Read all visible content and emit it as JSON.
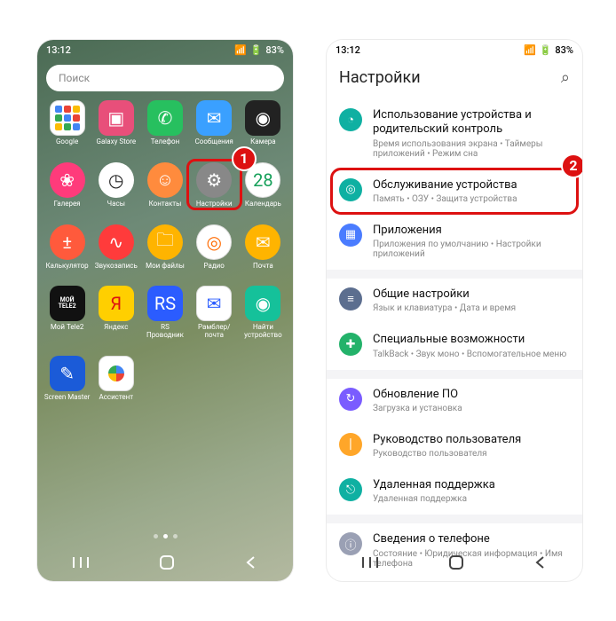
{
  "status": {
    "time": "13:12",
    "battery": "83%"
  },
  "left": {
    "search_placeholder": "Поиск",
    "apps": [
      {
        "label": "Google",
        "icon": "google-folder",
        "bg": "bg-white"
      },
      {
        "label": "Galaxy Store",
        "icon": "▣",
        "bg": "bg-pink"
      },
      {
        "label": "Телефон",
        "icon": "✆",
        "bg": "bg-green"
      },
      {
        "label": "Сообщения",
        "icon": "✉",
        "bg": "bg-msg"
      },
      {
        "label": "Камера",
        "icon": "◉",
        "bg": "bg-cam"
      },
      {
        "label": "Галерея",
        "icon": "❀",
        "bg": "bg-gal"
      },
      {
        "label": "Часы",
        "icon": "◷",
        "bg": "bg-clock"
      },
      {
        "label": "Контакты",
        "icon": "☺",
        "bg": "bg-contact"
      },
      {
        "label": "Настройки",
        "icon": "⚙",
        "bg": "bg-gear"
      },
      {
        "label": "Календарь",
        "icon": "28",
        "bg": "bg-cal"
      },
      {
        "label": "Калькулятор",
        "icon": "±",
        "bg": "bg-calc"
      },
      {
        "label": "Звукозапись",
        "icon": "∿",
        "bg": "bg-rec"
      },
      {
        "label": "Мои файлы",
        "icon": "🗀",
        "bg": "bg-files"
      },
      {
        "label": "Радио",
        "icon": "◎",
        "bg": "bg-radio"
      },
      {
        "label": "Почта",
        "icon": "✉",
        "bg": "bg-mail"
      },
      {
        "label": "Мой Tele2",
        "icon": "TELE2",
        "bg": "bg-tele2"
      },
      {
        "label": "Яндекс",
        "icon": "Я",
        "bg": "bg-yx"
      },
      {
        "label": "RS Проводник",
        "icon": "RS",
        "bg": "bg-rs"
      },
      {
        "label": "Рамблер/ почта",
        "icon": "✉",
        "bg": "bg-ram"
      },
      {
        "label": "Найти устройство",
        "icon": "◉",
        "bg": "bg-find"
      },
      {
        "label": "Screen Master",
        "icon": "✎",
        "bg": "bg-scr"
      },
      {
        "label": "Ассистент",
        "icon": "asst",
        "bg": "bg-asst"
      }
    ],
    "highlight_app_index": 8,
    "badge1": "1"
  },
  "right": {
    "header": "Настройки",
    "badge2": "2",
    "items": [
      {
        "icon": "◔",
        "color": "#0fb0a2",
        "title": "Использование устройства и родительский контроль",
        "sub": "Время использования экрана • Таймеры приложений • Режим сна"
      },
      {
        "icon": "◎",
        "color": "#0fb0a2",
        "title": "Обслуживание устройства",
        "sub": "Память • ОЗУ • Защита устройства",
        "highlight": true
      },
      {
        "icon": "▦",
        "color": "#4a7cff",
        "title": "Приложения",
        "sub": "Приложения по умолчанию • Настройки приложений"
      },
      {
        "gap": true
      },
      {
        "icon": "≡",
        "color": "#5c6e8f",
        "title": "Общие настройки",
        "sub": "Язык и клавиатура • Дата и время"
      },
      {
        "icon": "✚",
        "color": "#23b26a",
        "title": "Специальные возможности",
        "sub": "TalkBack • Звук моно • Вспомогательное меню"
      },
      {
        "gap": true
      },
      {
        "icon": "↻",
        "color": "#7a5cff",
        "title": "Обновление ПО",
        "sub": "Загрузка и установка"
      },
      {
        "icon": "❘",
        "color": "#ffa629",
        "title": "Руководство пользователя",
        "sub": "Руководство пользователя"
      },
      {
        "icon": "⎋",
        "color": "#0fb0a2",
        "title": "Удаленная поддержка",
        "sub": "Удаленная поддержка"
      },
      {
        "gap": true
      },
      {
        "icon": "ⓘ",
        "color": "#9aa0b4",
        "title": "Сведения о телефоне",
        "sub": "Состояние • Юридическая информация • Имя телефона"
      }
    ]
  }
}
